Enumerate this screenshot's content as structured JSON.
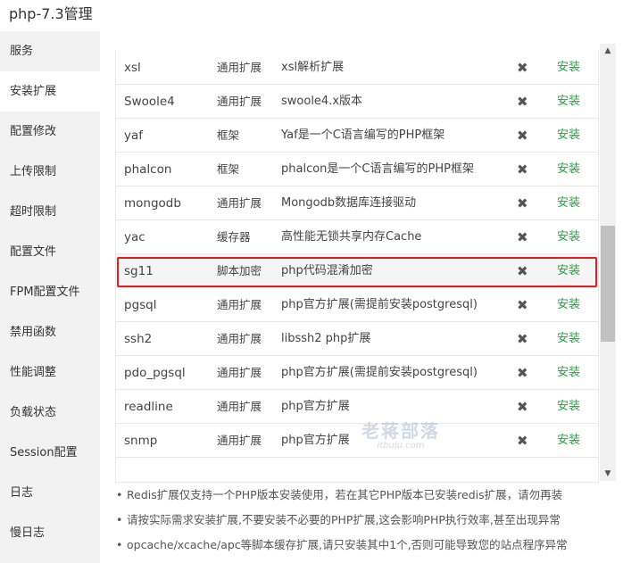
{
  "window": {
    "title": "php-7.3管理"
  },
  "sidebar": {
    "items": [
      {
        "label": "服务",
        "active": false
      },
      {
        "label": "安装扩展",
        "active": true
      },
      {
        "label": "配置修改",
        "active": false
      },
      {
        "label": "上传限制",
        "active": false
      },
      {
        "label": "超时限制",
        "active": false
      },
      {
        "label": "配置文件",
        "active": false
      },
      {
        "label": "FPM配置文件",
        "active": false
      },
      {
        "label": "禁用函数",
        "active": false
      },
      {
        "label": "性能调整",
        "active": false
      },
      {
        "label": "负载状态",
        "active": false
      },
      {
        "label": "Session配置",
        "active": false
      },
      {
        "label": "日志",
        "active": false
      },
      {
        "label": "慢日志",
        "active": false
      }
    ]
  },
  "extensions": [
    {
      "name": "xsl",
      "type": "通用扩展",
      "desc": "xsl解析扩展",
      "status": "✖",
      "action": "安装"
    },
    {
      "name": "Swoole4",
      "type": "通用扩展",
      "desc": "swoole4.x版本",
      "status": "✖",
      "action": "安装"
    },
    {
      "name": "yaf",
      "type": "框架",
      "desc": "Yaf是一个C语言编写的PHP框架",
      "status": "✖",
      "action": "安装"
    },
    {
      "name": "phalcon",
      "type": "框架",
      "desc": "phalcon是一个C语言编写的PHP框架",
      "status": "✖",
      "action": "安装"
    },
    {
      "name": "mongodb",
      "type": "通用扩展",
      "desc": "Mongodb数据库连接驱动",
      "status": "✖",
      "action": "安装"
    },
    {
      "name": "yac",
      "type": "缓存器",
      "desc": "高性能无锁共享内存Cache",
      "status": "✖",
      "action": "安装"
    },
    {
      "name": "sg11",
      "type": "脚本加密",
      "desc": "php代码混淆加密",
      "status": "✖",
      "action": "安装",
      "highlighted": true
    },
    {
      "name": "pgsql",
      "type": "通用扩展",
      "desc": "php官方扩展(需提前安装postgresql)",
      "status": "✖",
      "action": "安装"
    },
    {
      "name": "ssh2",
      "type": "通用扩展",
      "desc": "libssh2 php扩展",
      "status": "✖",
      "action": "安装"
    },
    {
      "name": "pdo_pgsql",
      "type": "通用扩展",
      "desc": "php官方扩展(需提前安装postgresql)",
      "status": "✖",
      "action": "安装"
    },
    {
      "name": "readline",
      "type": "通用扩展",
      "desc": "php官方扩展",
      "status": "✖",
      "action": "安装"
    },
    {
      "name": "snmp",
      "type": "通用扩展",
      "desc": "php官方扩展",
      "status": "✖",
      "action": "安装"
    }
  ],
  "watermark": {
    "line1": "老蒋部落",
    "line2": "itbulu.com"
  },
  "notes": [
    "Redis扩展仅支持一个PHP版本安装使用，若在其它PHP版本已安装redis扩展，请勿再装",
    "请按实际需求安装扩展,不要安装不必要的PHP扩展,这会影响PHP执行效率,甚至出现异常",
    "opcache/xcache/apc等脚本缓存扩展,请只安装其中1个,否则可能导致您的站点程序异常"
  ],
  "scrollbar": {
    "up_glyph": "▲",
    "down_glyph": "▼"
  },
  "bullet": "•",
  "colors": {
    "install_green": "#20a53a",
    "highlight_red": "#e02020",
    "sidebar_bg": "#f2f2f2"
  }
}
